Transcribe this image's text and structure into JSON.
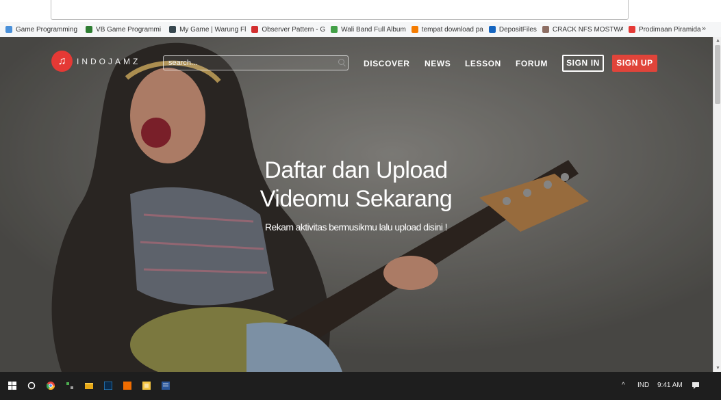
{
  "bookmarks": {
    "items": [
      {
        "label": "Game Programming",
        "icon": "page-icon",
        "color": "#4a90d9"
      },
      {
        "label": "VB Game Programmi",
        "icon": "game-icon",
        "color": "#2e7d32"
      },
      {
        "label": "My Game | Warung Fl",
        "icon": "image-icon",
        "color": "#37474f"
      },
      {
        "label": "Observer Pattern - G",
        "icon": "ant-icon",
        "color": "#d32f2f"
      },
      {
        "label": "Wali Band Full Album",
        "icon": "people-icon",
        "color": "#43a047"
      },
      {
        "label": "tempat download pa",
        "icon": "blogger-icon",
        "color": "#f57c00"
      },
      {
        "label": "DepositFiles",
        "icon": "file-icon",
        "color": "#1565c0"
      },
      {
        "label": "CRACK NFS MOSTWA",
        "icon": "hammer-icon",
        "color": "#8d6e63"
      },
      {
        "label": "Prodimaan Piramida",
        "icon": "triangle-icon",
        "color": "#e53935"
      }
    ],
    "more": "»"
  },
  "site": {
    "logo_text": "INDOJAMZ",
    "logo_glyph": "♫",
    "search_placeholder": "search...",
    "nav": [
      "DISCOVER",
      "NEWS",
      "LESSON",
      "FORUM"
    ],
    "sign_in": "SIGN IN",
    "sign_up": "SIGN UP",
    "accent": "#e0443a"
  },
  "hero": {
    "title_line1": "Daftar dan Upload",
    "title_line2": "Videomu Sekarang",
    "subtitle": "Rekam aktivitas bermusikmu lalu upload disini !"
  },
  "taskbar": {
    "icons": [
      "windows-start-icon",
      "cortana-icon",
      "chrome-icon",
      "app-icon",
      "file-explorer-icon",
      "photoshop-icon",
      "app-orange-icon",
      "calculator-icon",
      "word-icon"
    ],
    "lang": "IND",
    "time": "9:41 AM",
    "tray_chevron": "^"
  }
}
